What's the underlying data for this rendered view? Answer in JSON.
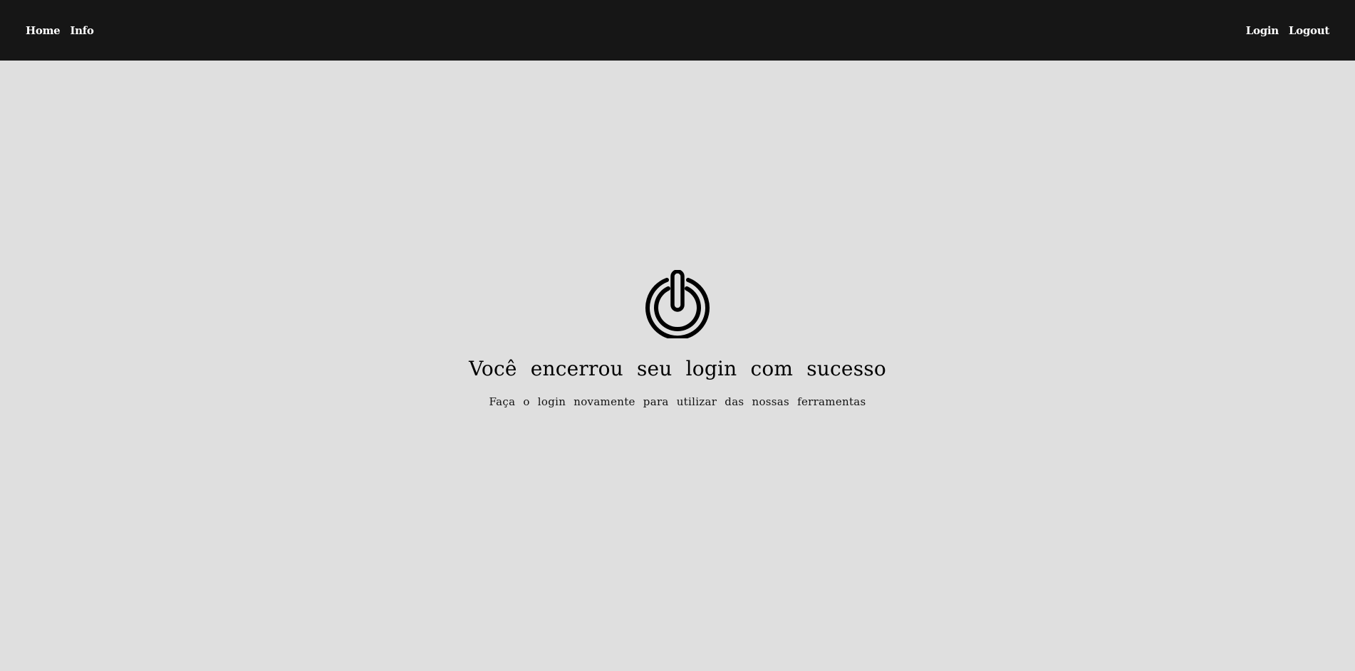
{
  "nav": {
    "left_links": [
      "Home",
      "Info"
    ],
    "right_links": [
      "Login",
      "Logout"
    ]
  },
  "logout_message": {
    "icon": "power-icon",
    "title": "Você encerrou seu login com sucesso",
    "subtitle": "Faça o login novamente para utilizar das nossas ferramentas"
  },
  "colors": {
    "navbar_bg": "#161616",
    "page_bg": "#dfdfdf",
    "nav_text": "#ffffff",
    "body_text": "#000000"
  }
}
